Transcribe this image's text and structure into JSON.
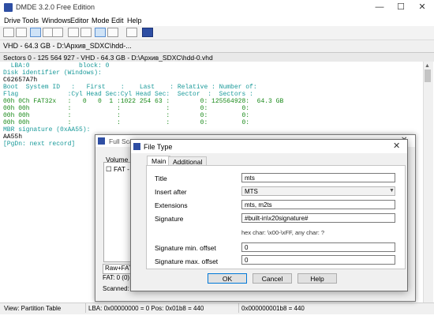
{
  "app": {
    "title": "DMDE 3.2.0 Free Edition"
  },
  "window_controls": {
    "minimize": "—",
    "maximize": "☐",
    "close": "✕"
  },
  "menu": [
    "Drive",
    "Tools",
    "Windows",
    "Editor",
    "Mode",
    "Edit",
    "Help"
  ],
  "tab": {
    "label": "VHD - 64.3 GB - D:\\Архив_SDXC\\hdd-..."
  },
  "sector_header": "Sectors 0 - 125 564 927 - VHD - 64.3 GB - D:\\Архив_SDXC\\hdd-0.vhd",
  "hex_lines": [
    {
      "text": "  LBA:0             block: 0",
      "color": "#1a9a9a"
    },
    {
      "text": "Disk identifier (Windows):",
      "color": "#1a9a9a"
    },
    {
      "text": "C62657A7h",
      "color": "#000000"
    },
    {
      "text": "Boot  System ID   :   First    :    Last    : Relative : Number of:",
      "color": "#1a9a9a"
    },
    {
      "text": "Flag             :Cyl Head Sec:Cyl Head Sec:  Sector  :  Sectors :",
      "color": "#1a9a9a"
    },
    {
      "text": "00h 0Ch FAT32x   :   0   0  1 :1022 254 63 :        0: 125564928:  64.3 GB",
      "color": "#1a8a1a"
    },
    {
      "text": "00h 00h          :            :            :        0:         0:",
      "color": "#1a8a1a"
    },
    {
      "text": "00h 00h          :            :            :        0:         0:",
      "color": "#1a8a1a"
    },
    {
      "text": "00h 00h          :            :            :        0:         0:",
      "color": "#1a8a1a"
    },
    {
      "text": "MBR signature (0xAA55):",
      "color": "#1a9a9a"
    },
    {
      "text": "AA55h",
      "color": "#000000"
    },
    {
      "text": "[PgDn: next record]",
      "color": "#1a9a9a"
    }
  ],
  "statusbar": {
    "view": "View:  Partition Table",
    "lba": "LBA: 0x00000000 = 0  Pos: 0x01b8 = 440",
    "offset": "0x000000001b8 = 440"
  },
  "full_scan": {
    "title": "Full Scan - DMDE 3.2.0",
    "volume_label": "Volume",
    "item": "☐ FAT - N",
    "raw": "Raw+FAT",
    "fat": "FAT: 0 (0)",
    "scanned": "Scanned: 125 56"
  },
  "dialog": {
    "title": "File Type",
    "tabs": [
      "Main",
      "Additional"
    ],
    "fields": {
      "title_label": "Title",
      "title_value": "mts",
      "insert_after_label": "Insert after",
      "insert_after_value": "MTS",
      "extensions_label": "Extensions",
      "extensions_value": "mts, m2ts",
      "signature_label": "Signature",
      "signature_value": "#built-in\\x20signature#",
      "hint": "hex char: \\x00-\\xFF, any char: ?",
      "sig_min_label": "Signature min. offset",
      "sig_min_value": "0",
      "sig_max_label": "Signature max. offset",
      "sig_max_value": "0"
    },
    "buttons": {
      "ok": "OK",
      "cancel": "Cancel",
      "help": "Help"
    }
  },
  "colors": {
    "accent": "#2e4ea3",
    "hex_cyan": "#1a9a9a",
    "hex_green": "#1a8a1a"
  }
}
